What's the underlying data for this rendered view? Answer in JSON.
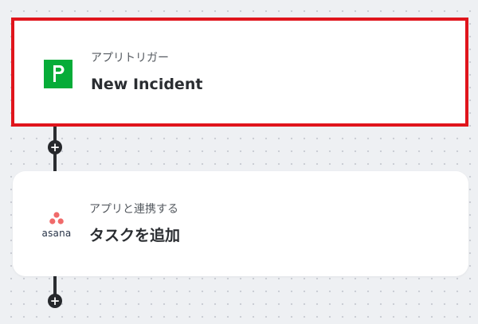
{
  "trigger": {
    "subtitle": "アプリトリガー",
    "title": "New Incident",
    "icon": "pagerduty-icon",
    "icon_color": "#06ac38",
    "highlight_color": "#e0151c"
  },
  "action": {
    "subtitle": "アプリと連携する",
    "title": "タスクを追加",
    "icon": "asana-icon",
    "icon_color": "#f06a6a",
    "logo_text": "asana"
  },
  "add_step": {
    "glyph": "+"
  }
}
